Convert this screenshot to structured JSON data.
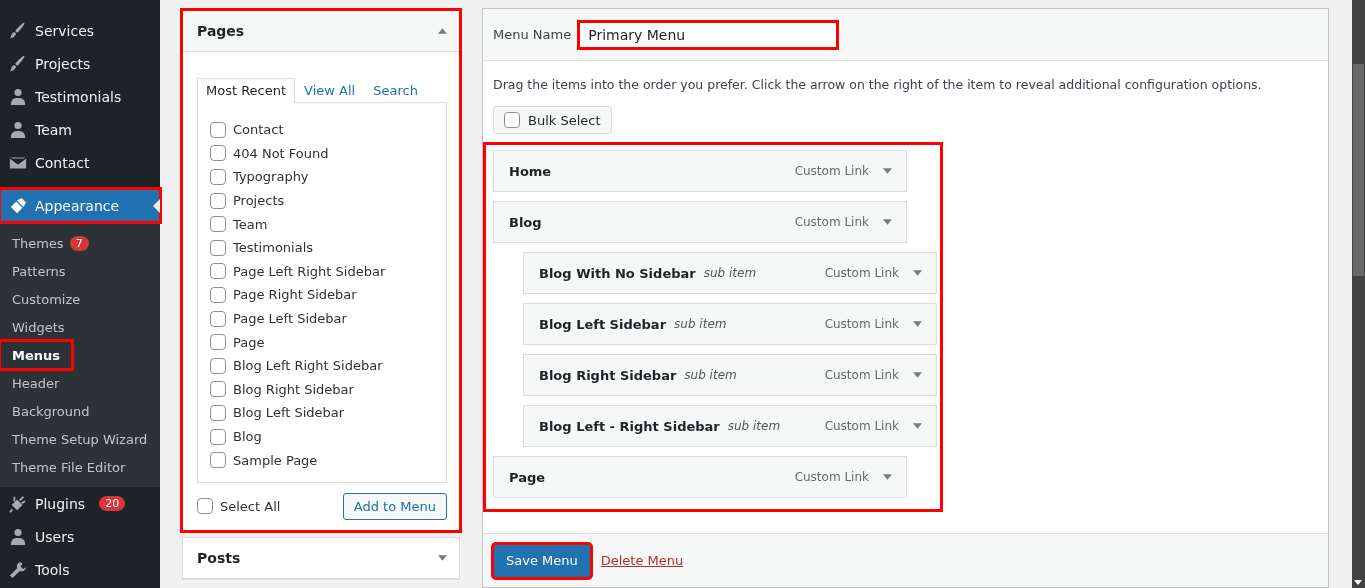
{
  "sidebar": {
    "items": [
      {
        "label": "Services",
        "kind": "brush",
        "selected": false,
        "highlighted": false
      },
      {
        "label": "Projects",
        "kind": "brush",
        "selected": false,
        "highlighted": false
      },
      {
        "label": "Testimonials",
        "kind": "person",
        "selected": false,
        "highlighted": false
      },
      {
        "label": "Team",
        "kind": "person",
        "selected": false,
        "highlighted": false
      },
      {
        "label": "Contact",
        "kind": "mail",
        "selected": false,
        "highlighted": false
      },
      {
        "label": "Appearance",
        "kind": "paint",
        "selected": true,
        "highlighted": true,
        "submenu": [
          {
            "label": "Themes",
            "badge": "7",
            "selected": false,
            "highlighted": false
          },
          {
            "label": "Patterns",
            "selected": false,
            "highlighted": false
          },
          {
            "label": "Customize",
            "selected": false,
            "highlighted": false
          },
          {
            "label": "Widgets",
            "selected": false,
            "highlighted": false
          },
          {
            "label": "Menus",
            "selected": true,
            "highlighted": true
          },
          {
            "label": "Header",
            "selected": false,
            "highlighted": false
          },
          {
            "label": "Background",
            "selected": false,
            "highlighted": false
          },
          {
            "label": "Theme Setup Wizard",
            "selected": false,
            "highlighted": false
          },
          {
            "label": "Theme File Editor",
            "selected": false,
            "highlighted": false
          }
        ]
      },
      {
        "label": "Plugins",
        "kind": "plug",
        "badge": "20",
        "selected": false,
        "highlighted": false
      },
      {
        "label": "Users",
        "kind": "person",
        "selected": false,
        "highlighted": false
      },
      {
        "label": "Tools",
        "kind": "wrench",
        "selected": false,
        "highlighted": false
      }
    ]
  },
  "pages_panel": {
    "title": "Pages",
    "highlighted": true,
    "expanded": true,
    "tabs": [
      {
        "label": "Most Recent",
        "selected": true
      },
      {
        "label": "View All",
        "selected": false
      },
      {
        "label": "Search",
        "selected": false
      }
    ],
    "items": [
      {
        "label": "Contact",
        "checked": false
      },
      {
        "label": "404 Not Found",
        "checked": false
      },
      {
        "label": "Typography",
        "checked": false
      },
      {
        "label": "Projects",
        "checked": false
      },
      {
        "label": "Team",
        "checked": false
      },
      {
        "label": "Testimonials",
        "checked": false
      },
      {
        "label": "Page Left Right Sidebar",
        "checked": false
      },
      {
        "label": "Page Right Sidebar",
        "checked": false
      },
      {
        "label": "Page Left Sidebar",
        "checked": false
      },
      {
        "label": "Page",
        "checked": false
      },
      {
        "label": "Blog Left Right Sidebar",
        "checked": false
      },
      {
        "label": "Blog Right Sidebar",
        "checked": false
      },
      {
        "label": "Blog Left Sidebar",
        "checked": false
      },
      {
        "label": "Blog",
        "checked": false
      },
      {
        "label": "Sample Page",
        "checked": false
      }
    ],
    "select_all": {
      "label": "Select All",
      "checked": false
    },
    "add_button": "Add to Menu"
  },
  "posts_panel": {
    "title": "Posts",
    "expanded": false
  },
  "menu_editor": {
    "name_label": "Menu Name",
    "name_value": "Primary Menu",
    "name_highlighted": true,
    "instructions": "Drag the items into the order you prefer. Click the arrow on the right of the item to reveal additional configuration options.",
    "bulk_select": {
      "label": "Bulk Select",
      "checked": false
    },
    "structure_highlighted": true,
    "items": [
      {
        "title": "Home",
        "type": "Custom Link"
      },
      {
        "title": "Blog",
        "type": "Custom Link",
        "children": [
          {
            "title": "Blog With No Sidebar",
            "note": "sub item",
            "type": "Custom Link"
          },
          {
            "title": "Blog Left Sidebar",
            "note": "sub item",
            "type": "Custom Link"
          },
          {
            "title": "Blog Right Sidebar",
            "note": "sub item",
            "type": "Custom Link"
          },
          {
            "title": "Blog Left - Right Sidebar",
            "note": "sub item",
            "type": "Custom Link"
          }
        ]
      },
      {
        "title": "Page",
        "type": "Custom Link"
      }
    ],
    "save_button": "Save Menu",
    "save_highlighted": true,
    "delete_link": "Delete Menu"
  }
}
